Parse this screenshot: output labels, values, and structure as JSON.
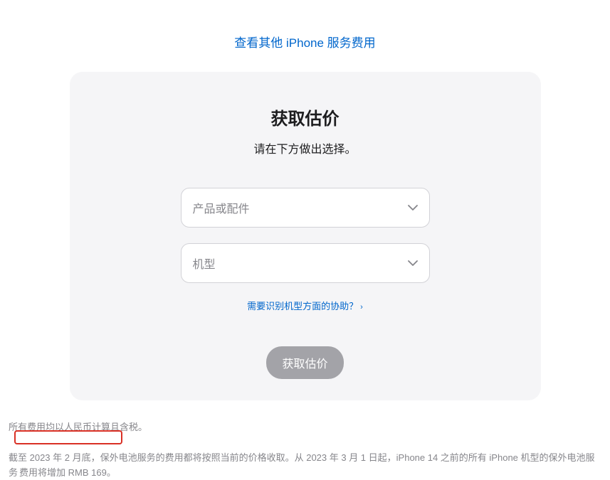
{
  "topLink": {
    "label": "查看其他 iPhone 服务费用"
  },
  "card": {
    "title": "获取估价",
    "subtitle": "请在下方做出选择。",
    "select1": {
      "placeholder": "产品或配件"
    },
    "select2": {
      "placeholder": "机型"
    },
    "helpLink": {
      "label": "需要识别机型方面的协助？"
    },
    "submit": {
      "label": "获取估价"
    }
  },
  "footnotes": {
    "line1": "所有费用均以人民币计算且含税。",
    "line2_a": "截至 2023 年 2 月底，保外电池服务的费用都将按照当前的价格收取。从 2023 年 3 月 1 日起，iPhone 14 之前的所有 iPhone 机型的保外电池服务",
    "line2_b": "费用将增加 RMB 169。"
  }
}
